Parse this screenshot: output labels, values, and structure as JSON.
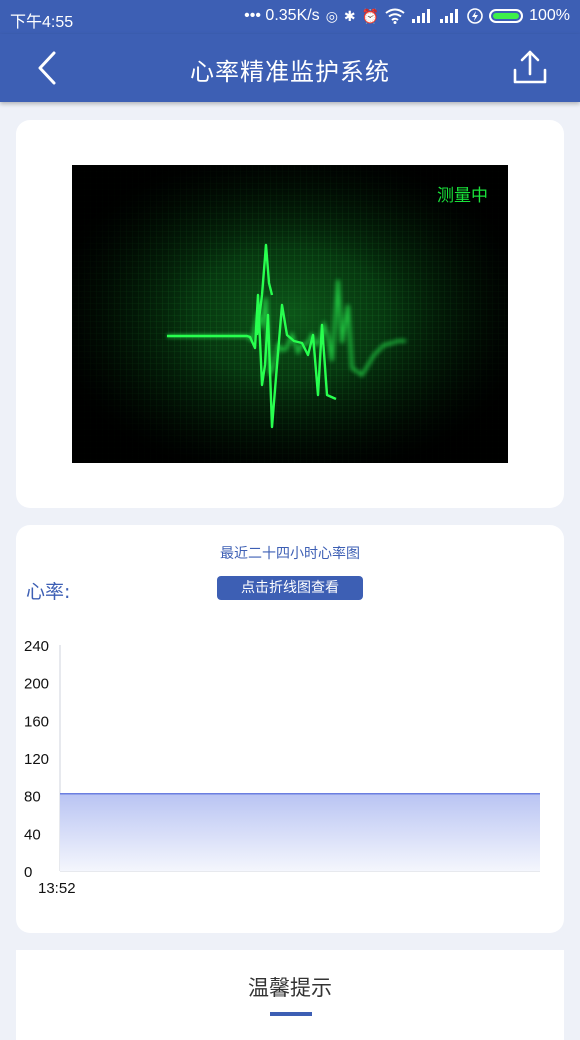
{
  "status_bar": {
    "time": "下午4:55",
    "speed": "••• 0.35K/s",
    "battery": "100%"
  },
  "header": {
    "title": "心率精准监护系统",
    "back_icon": "chevron-left-icon",
    "share_icon": "share-upload-icon"
  },
  "monitor": {
    "status_text": "测量中",
    "trace_color": "#19e23a"
  },
  "chart_section": {
    "subtitle": "最近二十四小时心率图",
    "heart_rate_label": "心率:",
    "view_button_label": "点击折线图查看"
  },
  "chart_data": {
    "type": "area",
    "x": [
      "13:52"
    ],
    "series": [
      {
        "values": [
          82,
          82
        ]
      }
    ],
    "ylim": [
      0,
      240
    ],
    "yticks": [
      0,
      40,
      80,
      120,
      160,
      200,
      240
    ],
    "xlabel": "",
    "ylabel": "",
    "grid": false,
    "line_color": "#6b7ee0"
  },
  "tips": {
    "title": "温馨提示"
  },
  "colors": {
    "primary": "#3d5fb4",
    "background": "#eef1f8"
  }
}
